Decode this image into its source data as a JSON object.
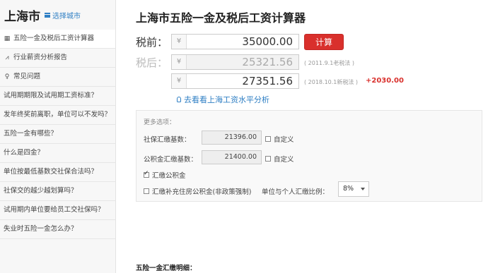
{
  "sidebar": {
    "city": "上海市",
    "select_city": "选择城市",
    "items": [
      {
        "label": "五险一金及税后工资计算器",
        "icon": "calculator-icon",
        "glyph": "▦"
      },
      {
        "label": "行业薪资分析报告",
        "icon": "trend-chart-icon",
        "glyph": "⩘"
      },
      {
        "label": "常见问题",
        "icon": "lightbulb-icon",
        "glyph": "♀"
      },
      {
        "label": "试用期期限及试用期工资标准？"
      },
      {
        "label": "发年终奖前离职，单位可以不发吗？"
      },
      {
        "label": "五险一金有哪些？"
      },
      {
        "label": "什么是四金？"
      },
      {
        "label": "单位按最低基数交社保合法吗？"
      },
      {
        "label": "社保交的越少越划算吗？"
      },
      {
        "label": "试用期内单位要给员工交社保吗？"
      },
      {
        "label": "失业时五险一金怎么办？"
      }
    ]
  },
  "main": {
    "title": "上海市五险一金及税后工资计算器",
    "pretax_label": "税前：",
    "aftertax_label": "税后：",
    "currency": "¥",
    "pretax_value": "35000.00",
    "calc_button": "计算",
    "aftertax_old": "25321.56",
    "aftertax_old_note": "( 2011.9.1老税法 )",
    "aftertax_new": "27351.56",
    "aftertax_new_note": "( 2018.10.1新税法 )",
    "difference": "+2030.00",
    "analysis_link": "去看看上海工资水平分析",
    "options": {
      "title": "更多选项：",
      "social_base_label": "社保汇缴基数：",
      "social_base_value": "21396.00",
      "custom_label": "自定义",
      "fund_base_label": "公积金汇缴基数：",
      "fund_base_value": "21400.00",
      "fund_checkbox": "汇缴公积金",
      "supp_fund_checkbox": "汇缴补充住房公积金(非政策强制)",
      "ratio_label": "单位与个人汇缴比例：",
      "ratio_value": "8%"
    },
    "detail_heading": "五险一金汇缴明细："
  }
}
